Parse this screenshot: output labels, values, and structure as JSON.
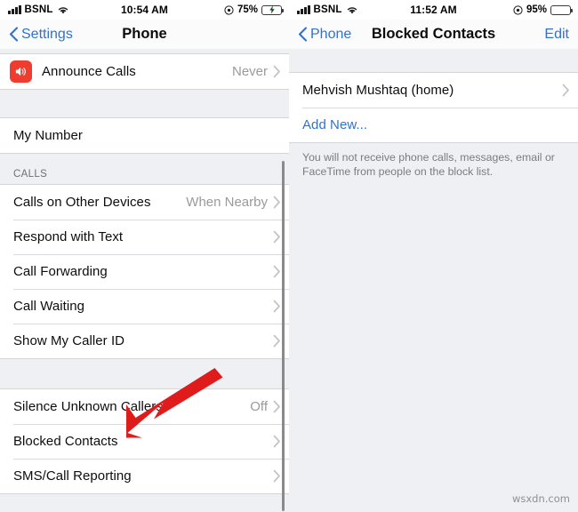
{
  "left_screen": {
    "status_bar": {
      "carrier": "BSNL",
      "time": "10:54 AM",
      "battery_percent": "75%",
      "battery_level": 75,
      "charging": true,
      "signal_bars": 4,
      "icons": [
        "signal-bars-icon",
        "wifi-icon",
        "location-icon",
        "battery-icon"
      ]
    },
    "nav": {
      "back_label": "Settings",
      "title": "Phone",
      "back_icon": "chevron-left-icon"
    },
    "sections": [
      {
        "header": "",
        "rows": [
          {
            "label": "Announce Calls",
            "value": "Never",
            "icon": "speaker-wave-icon",
            "icon_color": "#f03c2e",
            "chevron": true
          }
        ]
      },
      {
        "header": "",
        "rows": [
          {
            "label": "My Number",
            "value": "",
            "chevron": false
          }
        ]
      },
      {
        "header": "CALLS",
        "rows": [
          {
            "label": "Calls on Other Devices",
            "value": "When Nearby",
            "chevron": true
          },
          {
            "label": "Respond with Text",
            "value": "",
            "chevron": true
          },
          {
            "label": "Call Forwarding",
            "value": "",
            "chevron": true
          },
          {
            "label": "Call Waiting",
            "value": "",
            "chevron": true
          },
          {
            "label": "Show My Caller ID",
            "value": "",
            "chevron": true
          }
        ]
      },
      {
        "header": "",
        "rows": [
          {
            "label": "Silence Unknown Callers",
            "value": "Off",
            "chevron": true
          },
          {
            "label": "Blocked Contacts",
            "value": "",
            "chevron": true
          },
          {
            "label": "SMS/Call Reporting",
            "value": "",
            "chevron": true
          }
        ]
      }
    ]
  },
  "right_screen": {
    "status_bar": {
      "carrier": "BSNL",
      "time": "11:52 AM",
      "battery_percent": "95%",
      "battery_level": 95,
      "charging": false,
      "signal_bars": 4,
      "icons": [
        "signal-bars-icon",
        "wifi-icon",
        "location-icon",
        "battery-icon"
      ]
    },
    "nav": {
      "back_label": "Phone",
      "title": "Blocked Contacts",
      "edit_label": "Edit",
      "back_icon": "chevron-left-icon"
    },
    "rows": [
      {
        "label": "Mehvish Mushtaq (home)",
        "chevron": true,
        "link": false
      },
      {
        "label": "Add New...",
        "chevron": false,
        "link": true
      }
    ],
    "footnote": "You will not receive phone calls, messages, email or FaceTime from people on the block list."
  },
  "annotation": {
    "arrow_color": "#e01b1b",
    "points_to": "Blocked Contacts"
  },
  "watermark": "wsxdn.com",
  "colors": {
    "accent_blue": "#3272c8",
    "icon_red": "#f03c2e",
    "background_gray": "#eef0f4",
    "row_white": "#ffffff",
    "value_gray": "#9a9a9f",
    "separator": "#d9dade"
  }
}
